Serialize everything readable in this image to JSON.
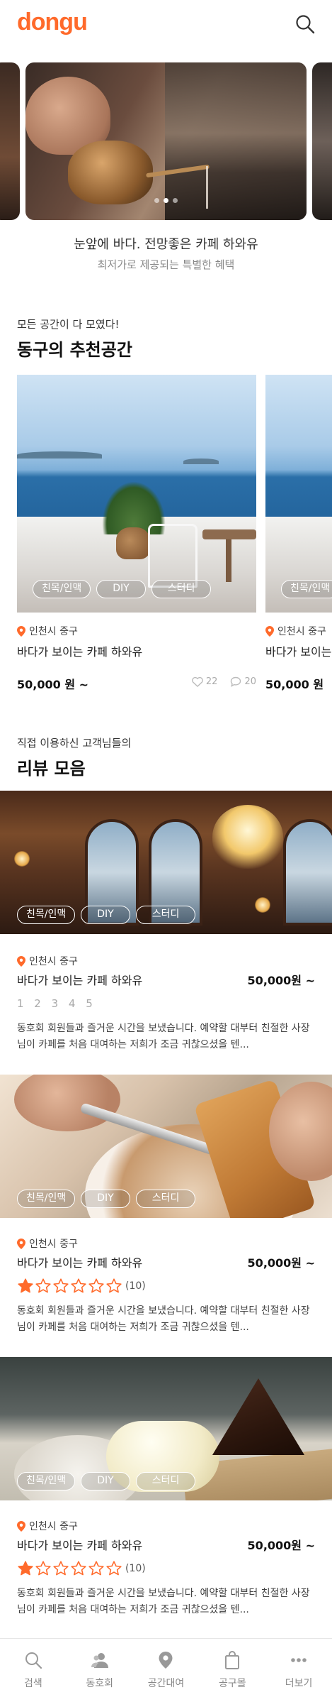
{
  "header": {
    "logo": "dongu"
  },
  "hero": {
    "title": "눈앞에 바다. 전망좋은 카페 하와유",
    "subtitle": "최저가로 제공되는 특별한 혜택",
    "slide_index": 2,
    "slide_count": 3
  },
  "recommended": {
    "kicker": "모든 공간이 다 모였다!",
    "title": "동구의 추천공간",
    "cards": [
      {
        "tags": [
          "친목/인맥",
          "DIY",
          "스터디"
        ],
        "location": "인천시 중구",
        "place": "바다가 보이는 카페 하와유",
        "price": "50,000 원 ~",
        "likes": "22",
        "comments": "20"
      },
      {
        "tags": [
          "친목/인맥"
        ],
        "location": "인천시 중구",
        "place": "바다가 보이는",
        "price": "50,000 원"
      }
    ]
  },
  "reviews": {
    "kicker": "직접 이용하신 고객님들의",
    "title": "리뷰 모음",
    "items": [
      {
        "tags": [
          "친목/인맥",
          "DIY",
          "스터디"
        ],
        "location": "인천시 중구",
        "place": "바다가 보이는 카페 하와유",
        "price": "50,000원 ~",
        "rating_text": "1 2 3 4 5",
        "text": "동호회 회원들과 즐거운 시간을 보냈습니다. 예약할 대부터 친절한 사장님이 카페를 처음 대여하는 저희가 조금 귀찮으셨을 텐..."
      },
      {
        "tags": [
          "친목/인맥",
          "DIY",
          "스터디"
        ],
        "location": "인천시 중구",
        "place": "바다가 보이는 카페 하와유",
        "price": "50,000원 ~",
        "rating": 1,
        "max_rating": 6,
        "rating_count": "(10)",
        "text": "동호회 회원들과 즐거운 시간을 보냈습니다. 예약할 대부터 친절한 사장님이 카페를 처음 대여하는 저희가 조금 귀찮으셨을 텐..."
      },
      {
        "tags": [
          "친목/인맥",
          "DIY",
          "스터디"
        ],
        "location": "인천시 중구",
        "place": "바다가 보이는 카페 하와유",
        "price": "50,000원 ~",
        "rating": 1,
        "max_rating": 6,
        "rating_count": "(10)",
        "text": "동호회 회원들과 즐거운 시간을 보냈습니다. 예약할 대부터 친절한 사장님이 카페를 처음 대여하는 저희가 조금 귀찮으셨을 텐..."
      }
    ]
  },
  "bottom_nav": [
    {
      "label": "검색",
      "icon": "search-icon"
    },
    {
      "label": "동호회",
      "icon": "people-icon"
    },
    {
      "label": "공간대여",
      "icon": "location-pin-icon"
    },
    {
      "label": "공구몰",
      "icon": "shopping-bag-icon"
    },
    {
      "label": "더보기",
      "icon": "more-icon"
    }
  ],
  "colors": {
    "brand": "#ff6a2b",
    "star": "#ff6a2b",
    "pin": "#ff6a2b"
  }
}
